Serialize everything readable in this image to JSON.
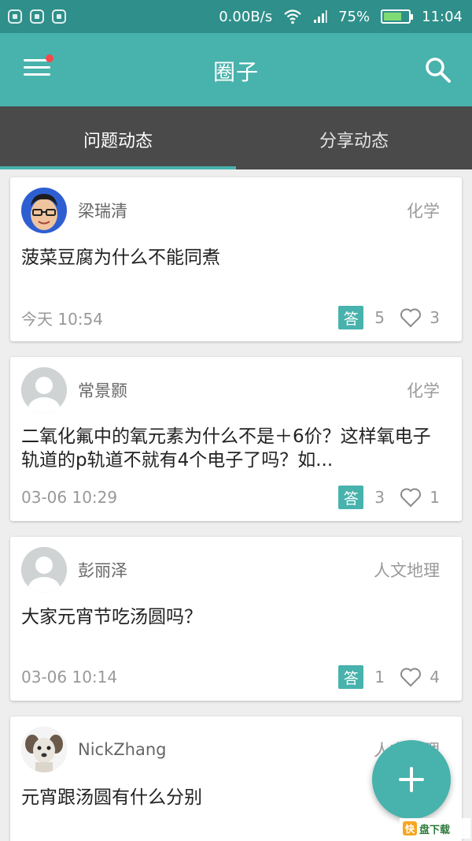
{
  "status_bar": {
    "net_speed": "0.00B/s",
    "battery_percent": "75%",
    "battery_level": 0.75,
    "time": "11:04"
  },
  "app_bar": {
    "title": "圈子",
    "menu_icon": "hamburger-menu-icon",
    "search_icon": "search-icon",
    "notification_dot_color": "#f24a4a"
  },
  "tabs": [
    {
      "label": "问题动态",
      "active": true
    },
    {
      "label": "分享动态",
      "active": false
    }
  ],
  "posts": [
    {
      "author": "梁瑞清",
      "category": "化学",
      "title": "菠菜豆腐为什么不能同煮",
      "time": "今天 10:54",
      "answer_badge": "答",
      "answers": "5",
      "likes": "3",
      "avatar": "photo-man-glasses"
    },
    {
      "author": "常景颢",
      "category": "化学",
      "title": "二氧化氟中的氧元素为什么不是＋6价？这样氧电子轨道的p轨道不就有4个电子了吗？如...",
      "time": "03-06 10:29",
      "answer_badge": "答",
      "answers": "3",
      "likes": "1",
      "avatar": "default-avatar"
    },
    {
      "author": "彭丽泽",
      "category": "人文地理",
      "title": "大家元宵节吃汤圆吗？",
      "time": "03-06 10:14",
      "answer_badge": "答",
      "answers": "1",
      "likes": "4",
      "avatar": "default-avatar"
    },
    {
      "author": "NickZhang",
      "category": "人文地理",
      "title": "元宵跟汤圆有什么分别",
      "avatar": "photo-dog"
    }
  ],
  "fab": {
    "icon": "plus-icon"
  },
  "watermark": {
    "text": "盘下载",
    "logo": "快"
  },
  "colors": {
    "accent": "#48b2ac",
    "status_bar": "#2f8f8a",
    "tab_bar": "#4a4a4a"
  }
}
